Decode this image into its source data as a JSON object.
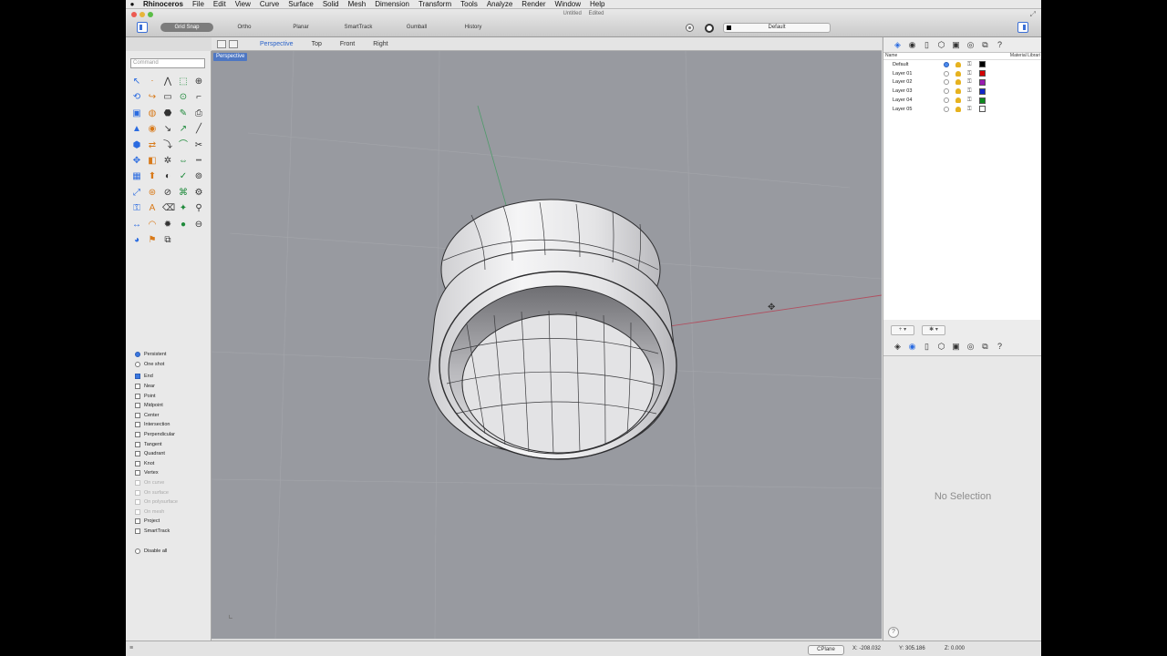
{
  "menubar": {
    "app_name": "Rhinoceros",
    "items": [
      "File",
      "Edit",
      "View",
      "Curve",
      "Surface",
      "Solid",
      "Mesh",
      "Dimension",
      "Transform",
      "Tools",
      "Analyze",
      "Render",
      "Window",
      "Help"
    ]
  },
  "window": {
    "title": "Untitled",
    "subtitle": "Edited"
  },
  "toolbar": {
    "modes": [
      "Grid Snap",
      "Ortho",
      "Planar",
      "SmartTrack",
      "Gumball",
      "History"
    ],
    "layer_selector": "Default"
  },
  "viewport_tabs": [
    "Perspective",
    "Top",
    "Front",
    "Right"
  ],
  "active_viewport_tab": "Perspective",
  "viewport": {
    "label": "Perspective",
    "background": "#989aa0"
  },
  "command": {
    "placeholder": "Command"
  },
  "tool_icons": [
    "select-icon",
    "point-icon",
    "polyline-icon",
    "zoom-window-icon",
    "zoom-icon",
    "rotate-view-icon",
    "curve-icon",
    "rectangle-icon",
    "zoom-extents-icon",
    "polyline-tool-icon",
    "box-icon",
    "sphere-icon",
    "cylinder-icon",
    "patch-icon",
    "printer-icon",
    "cone-icon",
    "paint-icon",
    "fillet-icon",
    "chamfer-icon",
    "line-icon",
    "solid-icon",
    "join-icon",
    "curve-tool-icon",
    "bend-icon",
    "trim-icon",
    "move-icon",
    "split-icon",
    "explode-icon",
    "mirror-icon",
    "dash-line-icon",
    "grid-icon",
    "extrude-icon",
    "render-icon",
    "check-icon",
    "camera-icon",
    "scale-icon",
    "zoom-in-icon",
    "magnify-icon",
    "array-icon",
    "gear-tool-icon",
    "lock-icon",
    "text-icon",
    "eraser-icon",
    "star-icon",
    "pin-icon",
    "dimension-icon",
    "arc-icon",
    "color-wheel-icon",
    "disk-icon",
    "zoom-out-icon",
    "globe-icon",
    "flag-icon",
    "layers-icon"
  ],
  "tool_glyphs": [
    "↖",
    "⋅",
    "⋀",
    "⬚",
    "⊕",
    "⟲",
    "↪",
    "▭",
    "⊙",
    "⌐",
    "▣",
    "◍",
    "⬣",
    "✎",
    "⎙",
    "▲",
    "◉",
    "↘",
    "↗",
    "╱",
    "⬢",
    "⇄",
    "⤵",
    "⌒",
    "✂",
    "✥",
    "◧",
    "✲",
    "⇔",
    "┅",
    "▦",
    "⬆",
    "◐",
    "✓",
    "⊚",
    "⤢",
    "⊛",
    "⊘",
    "⌘",
    "⚙",
    "⚿",
    "A",
    "⌫",
    "✦",
    "⚲",
    "↔",
    "◠",
    "✹",
    "●",
    "⊖",
    "◕",
    "⚑",
    "⧉"
  ],
  "osnaps": {
    "mode": [
      {
        "label": "Persistent",
        "checked": true,
        "type": "radio"
      },
      {
        "label": "One shot",
        "checked": false,
        "type": "radio"
      }
    ],
    "items": [
      {
        "label": "End",
        "checked": true,
        "disabled": false
      },
      {
        "label": "Near",
        "checked": false,
        "disabled": false
      },
      {
        "label": "Point",
        "checked": false,
        "disabled": false
      },
      {
        "label": "Midpoint",
        "checked": false,
        "disabled": false
      },
      {
        "label": "Center",
        "checked": false,
        "disabled": false
      },
      {
        "label": "Intersection",
        "checked": false,
        "disabled": false
      },
      {
        "label": "Perpendicular",
        "checked": false,
        "disabled": false
      },
      {
        "label": "Tangent",
        "checked": false,
        "disabled": false
      },
      {
        "label": "Quadrant",
        "checked": false,
        "disabled": false
      },
      {
        "label": "Knot",
        "checked": false,
        "disabled": false
      },
      {
        "label": "Vertex",
        "checked": false,
        "disabled": false
      },
      {
        "label": "On curve",
        "checked": false,
        "disabled": true
      },
      {
        "label": "On surface",
        "checked": false,
        "disabled": true
      },
      {
        "label": "On polysurface",
        "checked": false,
        "disabled": true
      },
      {
        "label": "On mesh",
        "checked": false,
        "disabled": true
      },
      {
        "label": "Project",
        "checked": false,
        "disabled": false
      },
      {
        "label": "SmartTrack",
        "checked": false,
        "disabled": false
      }
    ],
    "disable_all": "Disable all"
  },
  "layers_panel": {
    "col_name": "Name",
    "col_material": "Material Librari",
    "layers": [
      {
        "name": "Default",
        "current": true,
        "color": "#000000"
      },
      {
        "name": "Layer 01",
        "current": false,
        "color": "#d40000"
      },
      {
        "name": "Layer 02",
        "current": false,
        "color": "#9a1ab0"
      },
      {
        "name": "Layer 03",
        "current": false,
        "color": "#1327c8"
      },
      {
        "name": "Layer 04",
        "current": false,
        "color": "#0d8a1e"
      },
      {
        "name": "Layer 05",
        "current": false,
        "color": "#ffffff"
      }
    ],
    "add_button": "+ ▾",
    "settings_button": "✱ ▾"
  },
  "properties": {
    "empty_text": "No Selection"
  },
  "statusbar": {
    "cplane": "CPlane",
    "x": "X: -208.032",
    "y": "Y: 305.186",
    "z": "Z: 0.000"
  },
  "colors": {
    "accent": "#2a62c9",
    "viewport_bg": "#989aa0",
    "x_axis": "#b05060",
    "y_axis": "#4f9a6a"
  }
}
